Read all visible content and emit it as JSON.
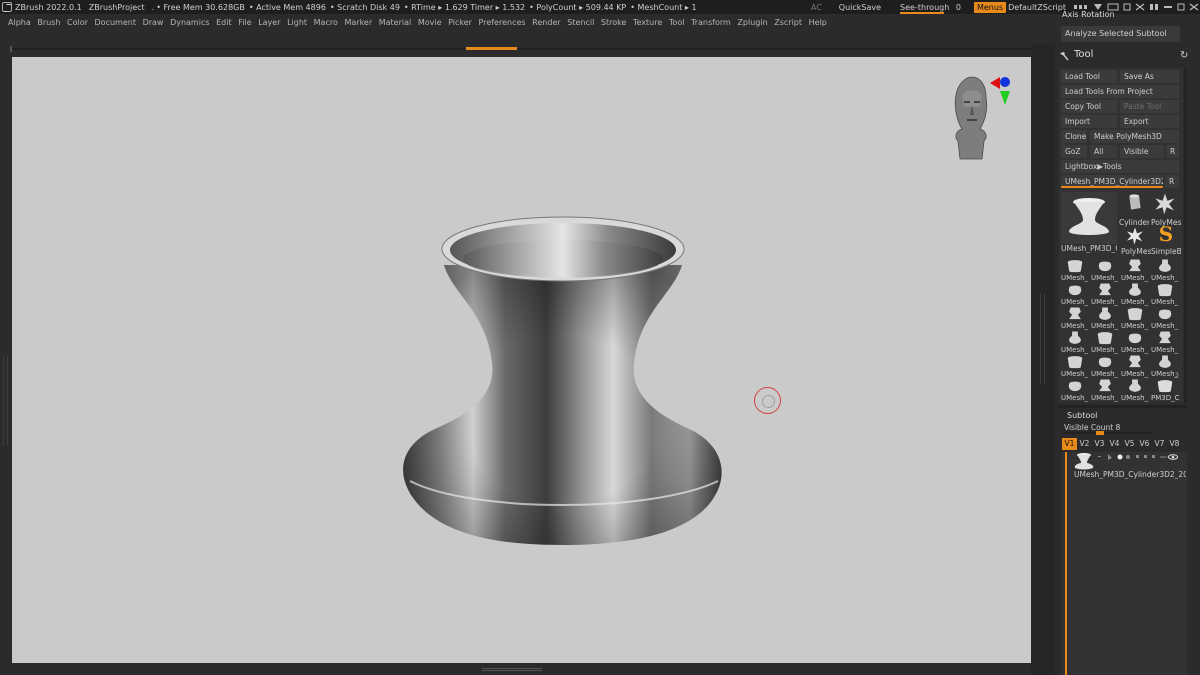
{
  "titlebar": {
    "app": "ZBrush 2022.0.1",
    "project": "ZBrushProject",
    "dot": ".",
    "free_mem": "• Free Mem 30.628GB",
    "active_mem": "• Active Mem 4896",
    "scratch": "• Scratch Disk 49",
    "rtime": "• RTime ▸ 1.629 Timer ▸ 1.532",
    "polycount": "• PolyCount ▸ 509.44 KP",
    "meshcount": "• MeshCount ▸ 1",
    "ac": "AC",
    "quicksave": "QuickSave",
    "see_through": "See-through",
    "see_through_value": "0",
    "menus": "Menus",
    "script": "DefaultZScript"
  },
  "menubar": {
    "items": [
      "Alpha",
      "Brush",
      "Color",
      "Document",
      "Draw",
      "Dynamics",
      "Edit",
      "File",
      "Layer",
      "Light",
      "Macro",
      "Marker",
      "Material",
      "Movie",
      "Picker",
      "Preferences",
      "Render",
      "Stencil",
      "Stroke",
      "Texture",
      "Tool",
      "Transform",
      "Zplugin",
      "Zscript",
      "Help"
    ]
  },
  "tray": {
    "axis_rotation": "Axis Rotation",
    "analyze": "Analyze Selected Subtool",
    "tool_title": "Tool",
    "buttons": {
      "load_tool": "Load Tool",
      "save_as": "Save As",
      "load_from_project": "Load Tools From Project",
      "copy_tool": "Copy Tool",
      "paste_tool": "Paste Tool",
      "import": "Import",
      "export": "Export",
      "clone": "Clone",
      "make_polymesh": "Make PolyMesh3D",
      "goz": "GoZ",
      "all": "All",
      "visible": "Visible",
      "r": "R",
      "lightbox_tools": "Lightbox▶Tools",
      "current_tool": "UMesh_PM3D_Cylinder3D2_2",
      "current_tool_r": "R"
    },
    "tool_grid": {
      "main_label": "UMesh_PM3D_C",
      "cylinder_label": "Cylinder",
      "polymesh_label": "PolyMes",
      "polymesh2_label": "PolyMes",
      "simplebrush_label": "SimpleB",
      "thumb_labels": [
        "UMesh_",
        "UMesh_",
        "UMesh_",
        "UMesh_",
        "UMesh_",
        "UMesh_",
        "UMesh_",
        "UMesh_",
        "UMesh_",
        "UMesh_",
        "UMesh_",
        "UMesh_",
        "UMesh_",
        "UMesh_",
        "UMesh_",
        "UMesh_",
        "UMesh_",
        "UMesh_",
        "UMesh_",
        "UMesh_",
        "UMesh_",
        "UMesh_",
        "UMesh_",
        "PM3D_C"
      ],
      "badge": "3"
    },
    "subtool": {
      "title": "Subtool",
      "visible_count": "Visible Count 8",
      "visible_count_fraction": 0.4,
      "v_buttons": [
        "V1",
        "V2",
        "V3",
        "V4",
        "V5",
        "V6",
        "V7",
        "V8"
      ],
      "item_label": "UMesh_PM3D_Cylinder3D2_20"
    }
  },
  "colors": {
    "accent": "#e88a1a",
    "canvas": "#cacaca",
    "panel": "#2b2b2b"
  }
}
